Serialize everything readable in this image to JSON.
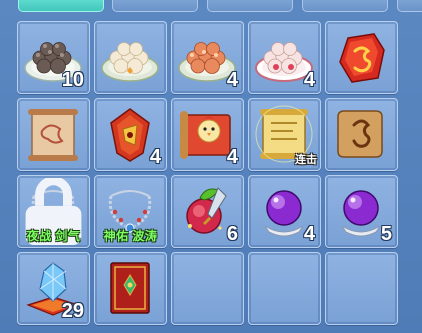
{
  "inventory": {
    "slots": [
      {
        "item": "dark-dumpling-plate-icon",
        "count": "10"
      },
      {
        "item": "white-dumpling-plate-icon",
        "count": ""
      },
      {
        "item": "red-dumpling-plate-icon",
        "count": "4"
      },
      {
        "item": "pink-dumpling-plate-icon",
        "count": "4"
      },
      {
        "item": "red-gem-icon",
        "count": ""
      },
      {
        "item": "scroll-paper-icon",
        "count": ""
      },
      {
        "item": "red-amulet-icon",
        "count": "4"
      },
      {
        "item": "chick-scroll-icon",
        "count": "4"
      },
      {
        "item": "golden-scroll-icon",
        "count": "",
        "tag": "连击"
      },
      {
        "item": "brown-scroll-icon",
        "count": ""
      },
      {
        "item": "necklace-icon",
        "count": "",
        "caption": "夜战 剑气",
        "locked": true
      },
      {
        "item": "necklace-icon",
        "count": "",
        "caption": "神佑 波涛"
      },
      {
        "item": "sword-fruit-icon",
        "count": "6"
      },
      {
        "item": "purple-orb-icon",
        "count": "4"
      },
      {
        "item": "purple-orb-icon",
        "count": "5"
      },
      {
        "item": "crystal-cushion-icon",
        "count": "29"
      },
      {
        "item": "red-book-icon",
        "count": ""
      },
      {
        "item": "",
        "count": ""
      },
      {
        "item": "",
        "count": ""
      },
      {
        "item": "",
        "count": ""
      }
    ]
  },
  "colors": {
    "background": "#5c88c2",
    "slot": "#86acd9",
    "active_tab": "#5fd8c9",
    "caption_green": "#7dff62"
  }
}
